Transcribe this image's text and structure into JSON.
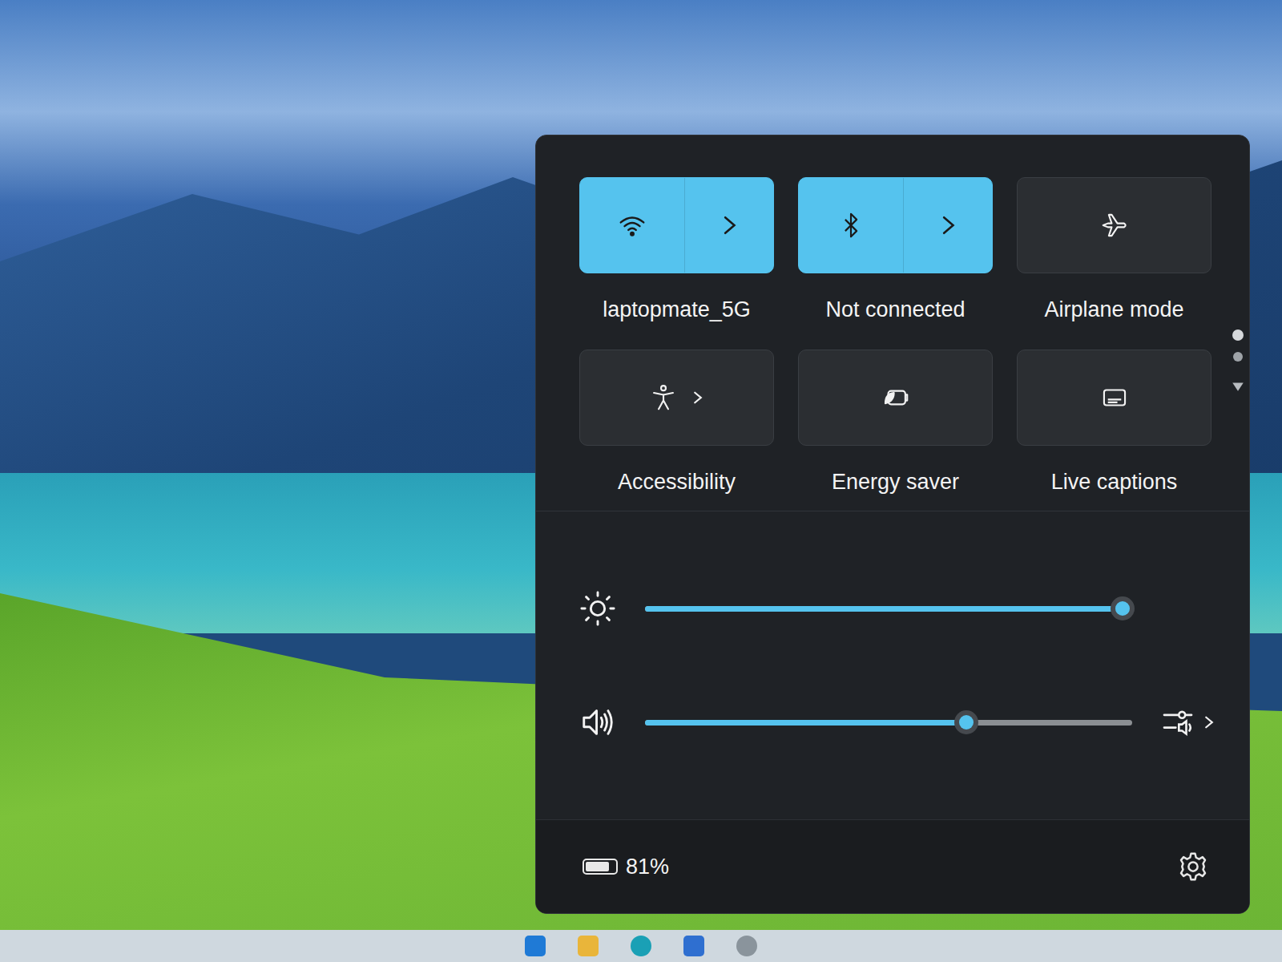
{
  "quick_settings": {
    "tiles": [
      {
        "label": "laptopmate_5G",
        "on": true,
        "expandable": true
      },
      {
        "label": "Not connected",
        "on": true,
        "expandable": true
      },
      {
        "label": "Airplane mode",
        "on": false,
        "expandable": false
      },
      {
        "label": "Accessibility",
        "on": false,
        "expandable": true
      },
      {
        "label": "Energy saver",
        "on": false,
        "expandable": false
      },
      {
        "label": "Live captions",
        "on": false,
        "expandable": false
      }
    ],
    "pages": [
      {
        "selected": true
      },
      {
        "selected": false
      }
    ],
    "sliders": [
      {
        "kind": "brightness",
        "level": 0.98
      },
      {
        "kind": "volume",
        "level": 0.66
      }
    ],
    "battery": {
      "text": "81%",
      "level": 0.81
    }
  }
}
